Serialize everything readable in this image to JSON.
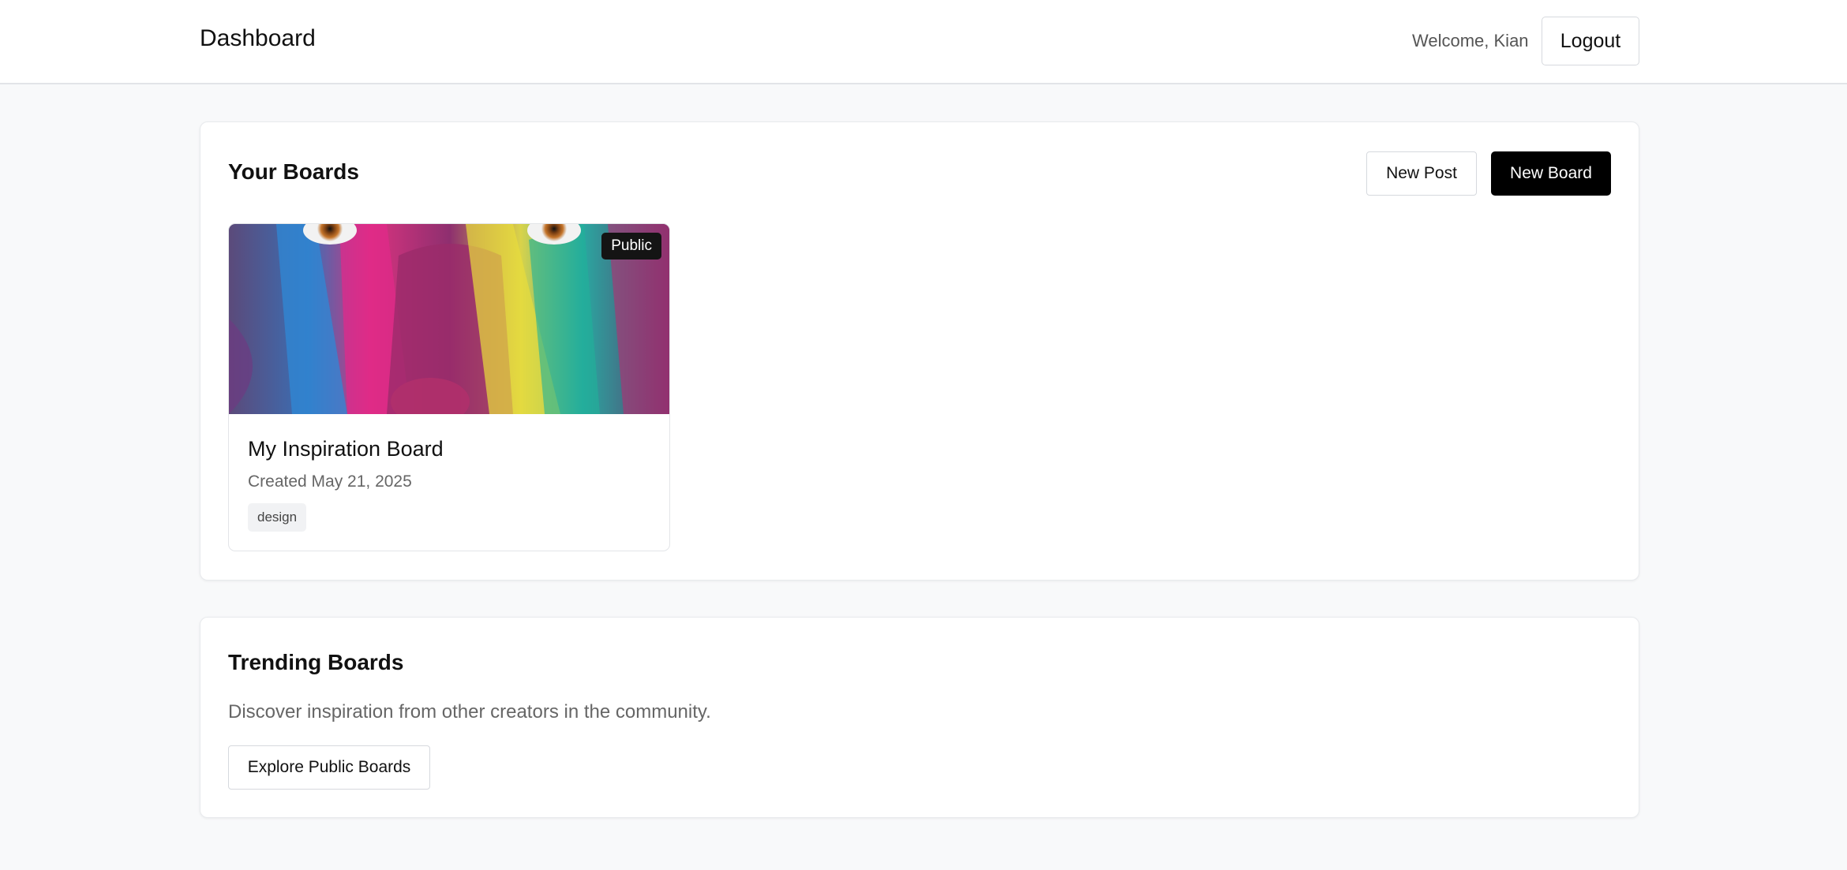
{
  "header": {
    "title": "Dashboard",
    "welcome": "Welcome, Kian",
    "logout_label": "Logout"
  },
  "your_boards": {
    "title": "Your Boards",
    "new_post_label": "New Post",
    "new_board_label": "New Board",
    "boards": [
      {
        "title": "My Inspiration Board",
        "created": "Created May 21, 2025",
        "visibility": "Public",
        "tags": [
          "design"
        ],
        "cover_image": "colorful-painted-face-photo"
      }
    ]
  },
  "trending": {
    "title": "Trending Boards",
    "description": "Discover inspiration from other creators in the community.",
    "explore_label": "Explore Public Boards"
  },
  "colors": {
    "background": "#f8f9fa",
    "primary_button": "#000000",
    "muted_text": "#666666"
  }
}
